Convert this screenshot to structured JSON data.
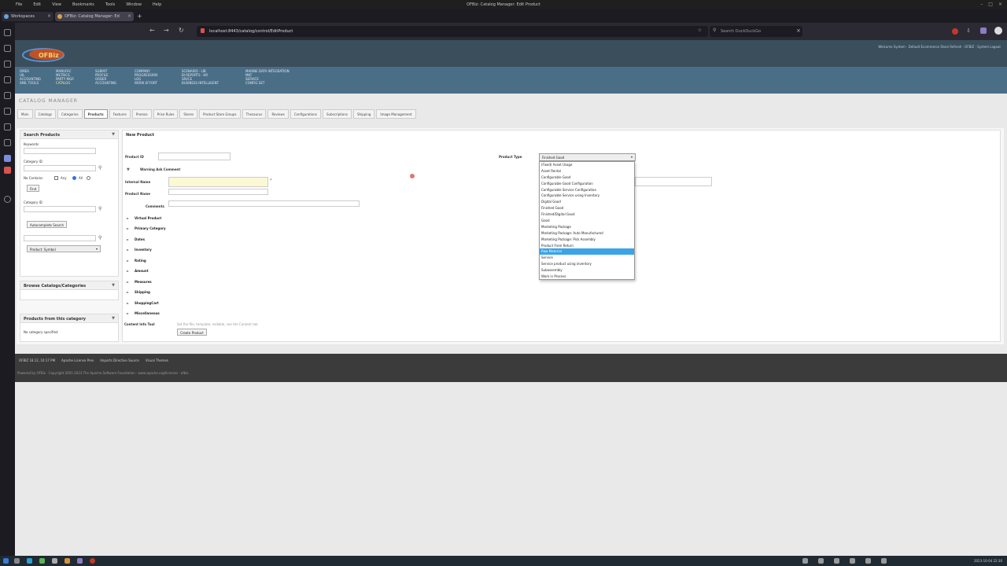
{
  "window": {
    "menu": [
      "File",
      "Edit",
      "View",
      "Bookmarks",
      "Tools",
      "Window",
      "Help"
    ],
    "title": "OFBiz: Catalog Manager: Edit Product"
  },
  "tabs": [
    {
      "label": "Workspaces"
    },
    {
      "label": "OFBiz: Catalog Manager: Ed"
    }
  ],
  "nav": {
    "url": "localhost:8443/catalog/control/EditProduct",
    "search_placeholder": "Search DuckDuckGo"
  },
  "header": {
    "welcome": "Welcome System · Default Ecommerce Store Refresh · OFBIZ · System Logout"
  },
  "appnav": [
    {
      "lines": [
        "OMEA",
        "UIL",
        "ACCOUNTING",
        "SMIL TOOLS"
      ]
    },
    {
      "lines": [
        "MANUFAC",
        "METRICS",
        "PARTY MGR",
        "CATALOG"
      ],
      "highlight": 3
    },
    {
      "lines": [
        "SUBMIT",
        "PROFILE",
        "ORDER",
        "ACCOUNTING"
      ]
    },
    {
      "lines": [
        "COMPANY",
        "PROGRESSION",
        "LOG",
        "WORK EFFORT"
      ]
    },
    {
      "lines": [
        "SCENARIO · LIB",
        "BI REPORTS · HR",
        "SRVCE",
        "BUSINESS INTELLIGENT"
      ]
    },
    {
      "lines": [
        "MARINE DATA INTEGRATION",
        "MKT",
        "SERVICE",
        "CONFIG SET"
      ]
    }
  ],
  "app_name": "CATALOG MANAGER",
  "app_tabs": [
    "Main",
    "Catalogs",
    "Categories",
    "Products",
    "Features",
    "Promos",
    "Price Rules",
    "Stores",
    "Product Store Groups",
    "Thesaurus",
    "Reviews",
    "Configurations",
    "Subscriptions",
    "Shipping",
    "Image Management"
  ],
  "active_tab": "Products",
  "left": {
    "search_title": "Search Products",
    "keywords_label": "Keywords",
    "category_id_label": "Category ID",
    "no_contains_label": "No Contains",
    "any_label": "Any",
    "all_label": "All",
    "find_button": "Find",
    "category_id2_label": "Category ID",
    "autocomplete_button": "Autocomplete Search",
    "product_select": "Product: Symbol",
    "browse_title": "Browse Catalogs/Categories",
    "products_cat_title": "Products from this category",
    "no_category": "No category specified"
  },
  "form": {
    "title": "New Product",
    "product_id_label": "Product ID",
    "warning_label": "Warning Ask Comment",
    "internal_name_label": "Internal Name",
    "product_name_label": "Product Name",
    "comments_label": "Comments",
    "sections": [
      "Virtual Product",
      "Primary Category",
      "Dates",
      "Inventory",
      "Rating",
      "Amount",
      "Measures",
      "Shipping",
      "ShoppingCart",
      "Miscellaneous"
    ],
    "content_info_label": "Content Info Tool",
    "content_info_text": "Set the file, template, sellable, see the Content tab",
    "create_button": "Create Product",
    "product_type_label": "Product Type",
    "product_type_value": "Finished Good",
    "product_type_options": [
      "(Fixed) Asset Usage",
      "Asset Rental",
      "Configurable Good",
      "Configurable Good Configuration",
      "Configurable Service Configuration",
      "Configurable Service using Inventory",
      "Digital Good",
      "Finished Good",
      "Finished/Digital Good",
      "Good",
      "Marketing Package",
      "Marketing Package: Auto Manufactured",
      "Marketing Package: Pick Assembly",
      "Product From Return",
      "Raw Material",
      "Service",
      "Service product using inventory",
      "Subassembly",
      "Work in Process"
    ],
    "selected_option": 14
  },
  "footer": {
    "items": [
      "OFBIZ 18.12, 10:17 PM",
      "Apache License Prev",
      "Imports Directive Source",
      "Visual Themes"
    ],
    "powered": "Powered by OFBiz · Copyright 2001-2023 The Apache Software Foundation · www.apache.org/licenses · ofbiz"
  },
  "taskbar": {
    "clock": "2023-10-04 22:36"
  },
  "colors": {
    "header": "#3a4e5c",
    "appnav": "#4b6e87",
    "selected_option": "#3ba3e8"
  }
}
